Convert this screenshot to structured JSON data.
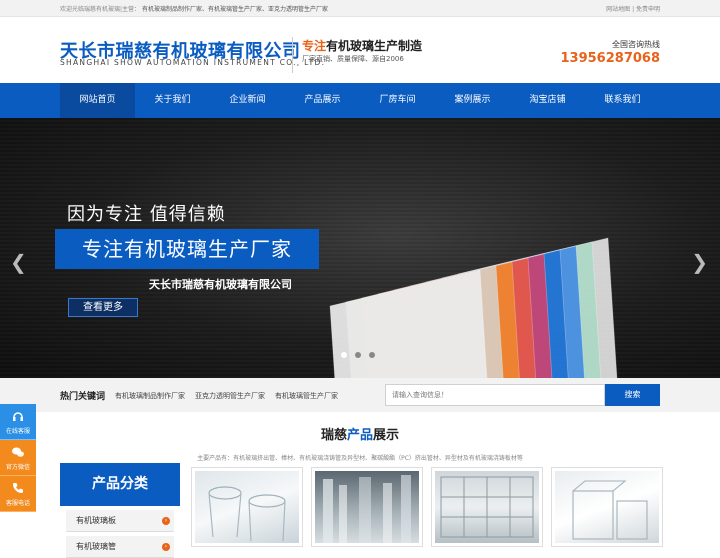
{
  "topbar": {
    "welcome_prefix": "欢迎光临瑞慈有机玻璃|主营：",
    "welcome_main": "有机玻璃制品制作厂家、有机玻璃管生产厂家、亚克力透明管生产厂家",
    "links": "网站地图 | 免责申明"
  },
  "header": {
    "logo_cn": "天长市瑞慈有机玻璃有限公司",
    "logo_en": "SHANGHAI SHOW AUTOMATION INSTRUMENT CO., LTD.",
    "slogan_accent": "专注",
    "slogan_rest": "有机玻璃生产制造",
    "slogan_sub": "厂家直销、质量保障、源自2006",
    "hotline_label": "全国咨询热线",
    "hotline": "13956287068"
  },
  "nav": {
    "items": [
      "网站首页",
      "关于我们",
      "企业新闻",
      "产品展示",
      "厂房车间",
      "案例展示",
      "淘宝店铺",
      "联系我们"
    ],
    "active_index": 0
  },
  "banner": {
    "line1": "因为专注  值得信赖",
    "line2": "专注有机玻璃生产厂家",
    "line3": "天长市瑞慈有机玻璃有限公司",
    "more_label": "查看更多",
    "slide_count": 3,
    "active_slide": 0,
    "sheet_colors": [
      "#e9e9e9",
      "#d6d2cc",
      "#f08a2e",
      "#e75a47",
      "#d9406a",
      "#1d6fd1",
      "#3c86e3",
      "#a9d9c4",
      "#f2f2f2"
    ]
  },
  "keywords": {
    "title": "热门关键词",
    "items": [
      "有机玻璃制品制作厂家",
      "亚克力透明管生产厂家",
      "有机玻璃管生产厂家"
    ],
    "search_placeholder": "请输入查询信息！",
    "search_button": "搜索"
  },
  "products": {
    "title_a": "瑞慈",
    "title_b": "产品",
    "title_c": "展示",
    "subtitle": "主要产品有：有机玻璃挤出管、棒材、有机玻璃浇铸管及异型材、聚碳酸酯（PC）挤出管材、异型材及有机玻璃浇铸板材等",
    "category_title": "产品分类",
    "categories": [
      "有机玻璃板",
      "有机玻璃管"
    ]
  },
  "side": {
    "items": [
      "在线客服",
      "官方微信",
      "客服电话"
    ]
  },
  "colors": {
    "brand_blue": "#0b5cc1",
    "accent_orange": "#e8621a"
  }
}
